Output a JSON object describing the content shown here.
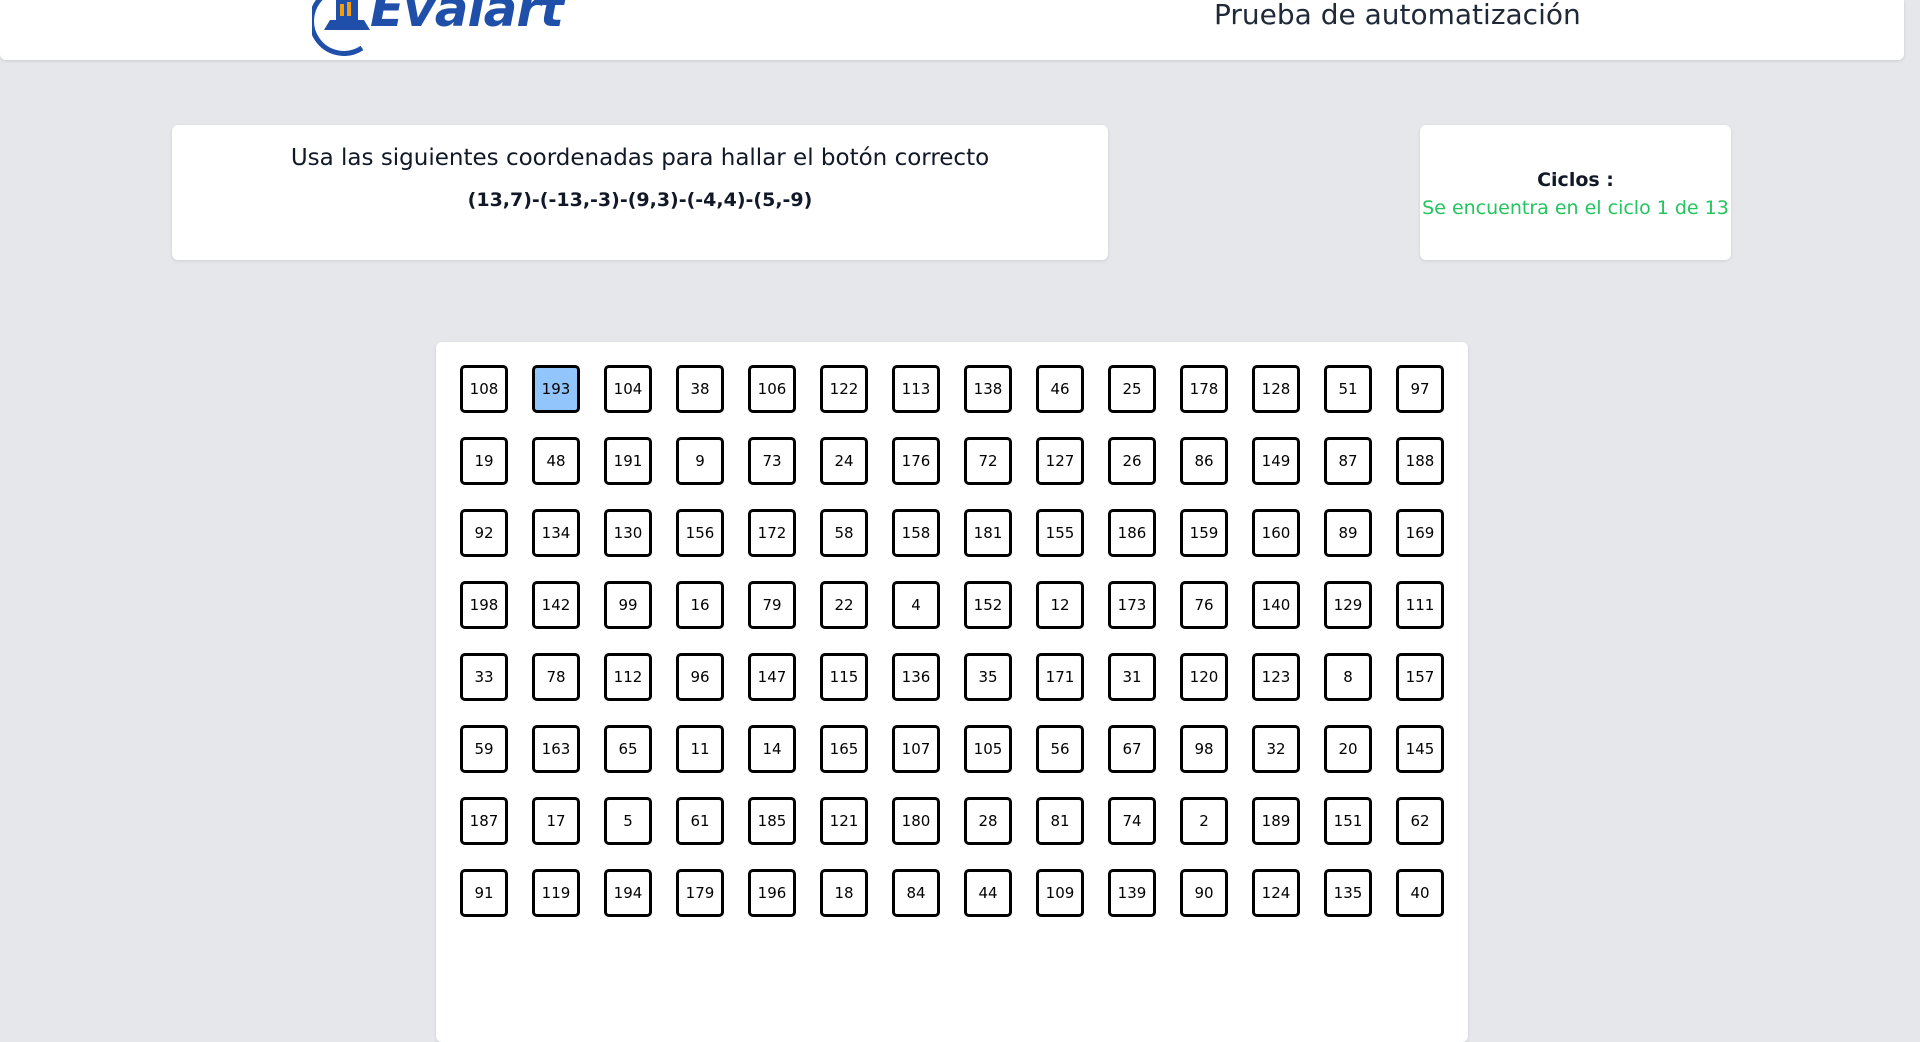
{
  "header": {
    "logo_text": "Evalart",
    "title": "Prueba de automatización"
  },
  "instructions": {
    "text": "Usa las siguientes coordenadas para hallar el botón correcto",
    "coordinates": "(13,7)-(-13,-3)-(9,3)-(-4,4)-(5,-9)"
  },
  "cycles": {
    "label": "Ciclos :",
    "status": "Se encuentra en el ciclo 1 de 13"
  },
  "colors": {
    "background": "#e5e7eb",
    "selected_cell": "#93c5fd",
    "status_text": "#22c55e",
    "logo_blue": "#1f4fa8",
    "logo_orange": "#f59e0b"
  },
  "grid": {
    "columns": 14,
    "selected_index": 1,
    "numbers": [
      "108",
      "193",
      "104",
      "38",
      "106",
      "122",
      "113",
      "138",
      "46",
      "25",
      "178",
      "128",
      "51",
      "97",
      "19",
      "48",
      "191",
      "9",
      "73",
      "24",
      "176",
      "72",
      "127",
      "26",
      "86",
      "149",
      "87",
      "188",
      "92",
      "134",
      "130",
      "156",
      "172",
      "58",
      "158",
      "181",
      "155",
      "186",
      "159",
      "160",
      "89",
      "169",
      "198",
      "142",
      "99",
      "16",
      "79",
      "22",
      "4",
      "152",
      "12",
      "173",
      "76",
      "140",
      "129",
      "111",
      "33",
      "78",
      "112",
      "96",
      "147",
      "115",
      "136",
      "35",
      "171",
      "31",
      "120",
      "123",
      "8",
      "157",
      "59",
      "163",
      "65",
      "11",
      "14",
      "165",
      "107",
      "105",
      "56",
      "67",
      "98",
      "32",
      "20",
      "145",
      "187",
      "17",
      "5",
      "61",
      "185",
      "121",
      "180",
      "28",
      "81",
      "74",
      "2",
      "189",
      "151",
      "62",
      "91",
      "119",
      "194",
      "179",
      "196",
      "18",
      "84",
      "44",
      "109",
      "139",
      "90",
      "124",
      "135",
      "40"
    ]
  }
}
